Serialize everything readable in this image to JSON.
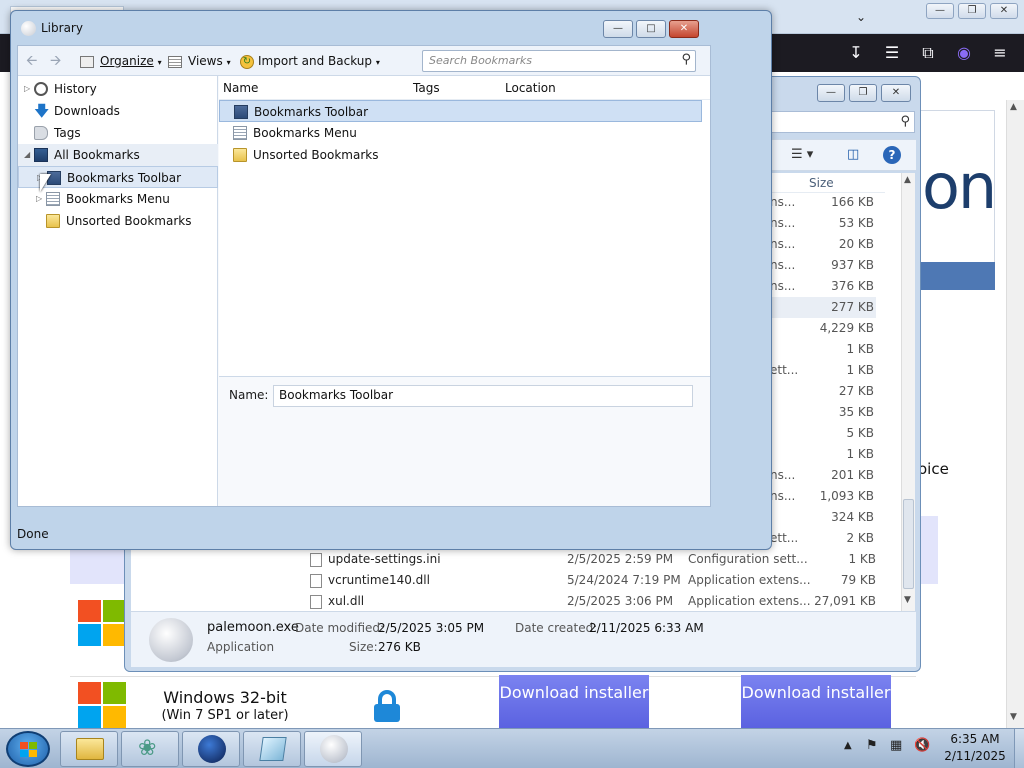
{
  "browser": {
    "banner_text": "on",
    "partial_text": "oice",
    "downloads": [
      {
        "title": "Windows 32-bit",
        "subtitle": "(Win 7 SP1 or later)",
        "button": "Download installer"
      },
      {
        "button": "Download installer"
      }
    ]
  },
  "explorer": {
    "size_header": "Size",
    "rows_partial": [
      {
        "type_fragment": "ns...",
        "size": "166 KB"
      },
      {
        "type_fragment": "ns...",
        "size": "53 KB"
      },
      {
        "type_fragment": "ns...",
        "size": "20 KB"
      },
      {
        "type_fragment": "ns...",
        "size": "937 KB"
      },
      {
        "type_fragment": "ns...",
        "size": "376 KB"
      },
      {
        "type_fragment": "",
        "size": "277 KB"
      },
      {
        "type_fragment": "",
        "size": "4,229 KB"
      },
      {
        "type_fragment": "",
        "size": "1 KB"
      },
      {
        "type_fragment": "ett...",
        "size": "1 KB"
      },
      {
        "type_fragment": "",
        "size": "27 KB"
      },
      {
        "type_fragment": "",
        "size": "35 KB"
      },
      {
        "type_fragment": "",
        "size": "5 KB"
      },
      {
        "type_fragment": "",
        "size": "1 KB"
      },
      {
        "type_fragment": "ns...",
        "size": "201 KB"
      },
      {
        "type_fragment": "ns...",
        "size": "1,093 KB"
      },
      {
        "type_fragment": "",
        "size": "324 KB"
      },
      {
        "type_fragment": "ett...",
        "size": "2 KB"
      }
    ],
    "rows": [
      {
        "name": "update-settings.ini",
        "date": "2/5/2025 2:59 PM",
        "type": "Configuration sett...",
        "size": "1 KB"
      },
      {
        "name": "vcruntime140.dll",
        "date": "5/24/2024 7:19 PM",
        "type": "Application extens...",
        "size": "79 KB"
      },
      {
        "name": "xul.dll",
        "date": "2/5/2025 3:06 PM",
        "type": "Application extens...",
        "size": "27,091 KB"
      }
    ],
    "details": {
      "filename": "palemoon.exe",
      "filetype": "Application",
      "modified_label": "Date modified:",
      "modified": "2/5/2025 3:05 PM",
      "created_label": "Date created:",
      "created": "2/11/2025 6:33 AM",
      "size_label": "Size:",
      "size": "276 KB"
    }
  },
  "library": {
    "title": "Library",
    "toolbar": {
      "organize": "Organize",
      "views": "Views",
      "import_backup": "Import and Backup",
      "search_placeholder": "Search Bookmarks"
    },
    "sidebar": [
      {
        "label": "History",
        "icon": "clock-icon"
      },
      {
        "label": "Downloads",
        "icon": "download-icon"
      },
      {
        "label": "Tags",
        "icon": "tag-icon"
      },
      {
        "label": "All Bookmarks",
        "icon": "bookmarks-icon"
      },
      {
        "label": "Bookmarks Toolbar",
        "icon": "toolbar-icon"
      },
      {
        "label": "Bookmarks Menu",
        "icon": "menu-icon"
      },
      {
        "label": "Unsorted Bookmarks",
        "icon": "folder-icon"
      }
    ],
    "columns": {
      "name": "Name",
      "tags": "Tags",
      "location": "Location"
    },
    "items": [
      {
        "label": "Bookmarks Toolbar",
        "icon": "toolbar-icon"
      },
      {
        "label": "Bookmarks Menu",
        "icon": "menu-icon"
      },
      {
        "label": "Unsorted Bookmarks",
        "icon": "folder-icon"
      }
    ],
    "name_label": "Name:",
    "name_value": "Bookmarks Toolbar",
    "status": "Done"
  },
  "taskbar": {
    "time": "6:35 AM",
    "date": "2/11/2025"
  }
}
